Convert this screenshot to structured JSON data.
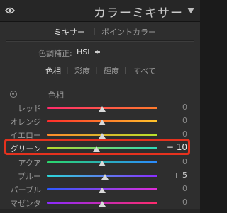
{
  "header": {
    "title": "カラーミキサー",
    "visibility_icon": "eye-icon",
    "collapse_icon": "triangle-down-icon"
  },
  "mode_switch": {
    "mixer": "ミキサー",
    "separator": "|",
    "point_color": "ポイントカラー"
  },
  "adjustment": {
    "label": "色調補正:",
    "value": "HSL ≑"
  },
  "tabs": {
    "hue": "色相",
    "saturation": "彩度",
    "luminance": "輝度",
    "all": "すべて",
    "separator": "|"
  },
  "section": {
    "label": "色相",
    "icon": "target-adjust-icon"
  },
  "sliders": [
    {
      "label": "レッド",
      "value": "0",
      "position": 0.5,
      "gradient": [
        "#ff2b6b",
        "#ff7b2b"
      ]
    },
    {
      "label": "オレンジ",
      "value": "0",
      "position": 0.5,
      "gradient": [
        "#ff2b2b",
        "#ffc42b"
      ]
    },
    {
      "label": "イエロー",
      "value": "0",
      "position": 0.5,
      "gradient": [
        "#ff8a2b",
        "#b8e22b"
      ]
    },
    {
      "label": "グリーン",
      "value": "− 10",
      "position": 0.45,
      "gradient": [
        "#b8d82b",
        "#2bd8b8"
      ]
    },
    {
      "label": "アクア",
      "value": "0",
      "position": 0.5,
      "gradient": [
        "#2bd86a",
        "#2b8aff"
      ]
    },
    {
      "label": "ブルー",
      "value": "+ 5",
      "position": 0.525,
      "gradient": [
        "#2bd8d8",
        "#8a2bff"
      ]
    },
    {
      "label": "パープル",
      "value": "0",
      "position": 0.5,
      "gradient": [
        "#2b5aff",
        "#e22bd8"
      ]
    },
    {
      "label": "マゼンタ",
      "value": "0",
      "position": 0.5,
      "gradient": [
        "#8a2bff",
        "#ff2b6b"
      ]
    }
  ],
  "colors": {
    "highlight": "#e5321e",
    "panel": "#2e2e2e",
    "header": "#262626"
  }
}
